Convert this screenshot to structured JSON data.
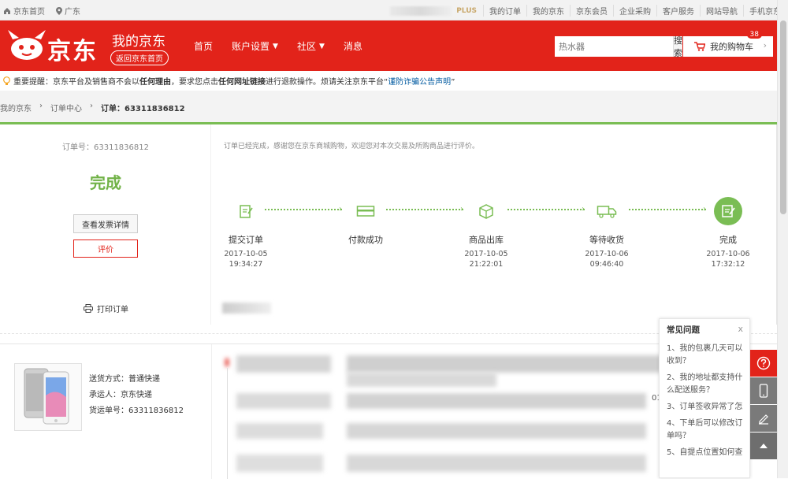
{
  "topbar": {
    "home": "京东首页",
    "location": "广东",
    "plus": "PLUS",
    "links": [
      "我的订单",
      "我的京东",
      "京东会员",
      "企业采购",
      "客户服务",
      "网站导航",
      "手机京东"
    ]
  },
  "header": {
    "logo_text": "京东",
    "title": "我的京东",
    "back_home": "返回京东首页",
    "nav": [
      "首页",
      "账户设置",
      "社区",
      "消息"
    ],
    "search_placeholder": "热水器",
    "search_button": "搜索",
    "cart_label": "我的购物车",
    "cart_count": "38"
  },
  "notice": {
    "prefix": "重要提醒：",
    "text1": "京东平台及销售商不会以",
    "strong1": "任何理由",
    "text2": "，要求您点击",
    "strong2": "任何网址链接",
    "text3": "进行退款操作。烦请关注京东平台“",
    "link": "谨防诈骗公告声明",
    "text4": "”"
  },
  "breadcrumb": [
    "我的京东",
    "订单中心",
    "订单：63311836812"
  ],
  "order": {
    "number_label": "订单号：63311836812",
    "status": "完成",
    "invoice_button": "查看发票详情",
    "review_button": "评价",
    "print": "打印订单",
    "thanks": "订单已经完成，感谢您在京东商城购物，欢迎您对本次交易及所购商品进行评价。"
  },
  "steps": [
    {
      "label": "提交订单",
      "date": "2017-10-05",
      "time": "19:34:27",
      "icon": "submit-order-icon"
    },
    {
      "label": "付款成功",
      "date": "",
      "time": "",
      "icon": "payment-icon"
    },
    {
      "label": "商品出库",
      "date": "2017-10-05",
      "time": "21:22:01",
      "icon": "package-out-icon"
    },
    {
      "label": "等待收货",
      "date": "2017-10-06",
      "time": "09:46:40",
      "icon": "truck-icon"
    },
    {
      "label": "完成",
      "date": "2017-10-06",
      "time": "17:32:12",
      "icon": "complete-icon"
    }
  ],
  "shipping": {
    "method": "送货方式：普通快递",
    "carrier": "承运人：京东快递",
    "tracking": "货运单号：63311836812",
    "blurred_suffix": "01"
  },
  "faq": {
    "title": "常见问题",
    "close": "x",
    "items": [
      "1、我的包裹几天可以收到？",
      "2、我的地址都支持什么配送服务？",
      "3、订单签收异常了怎",
      "4、下单后可以修改订单吗？",
      "5、自提点位置如何查"
    ]
  },
  "colors": {
    "brand_red": "#e2231a",
    "success_green": "#7abd54"
  }
}
